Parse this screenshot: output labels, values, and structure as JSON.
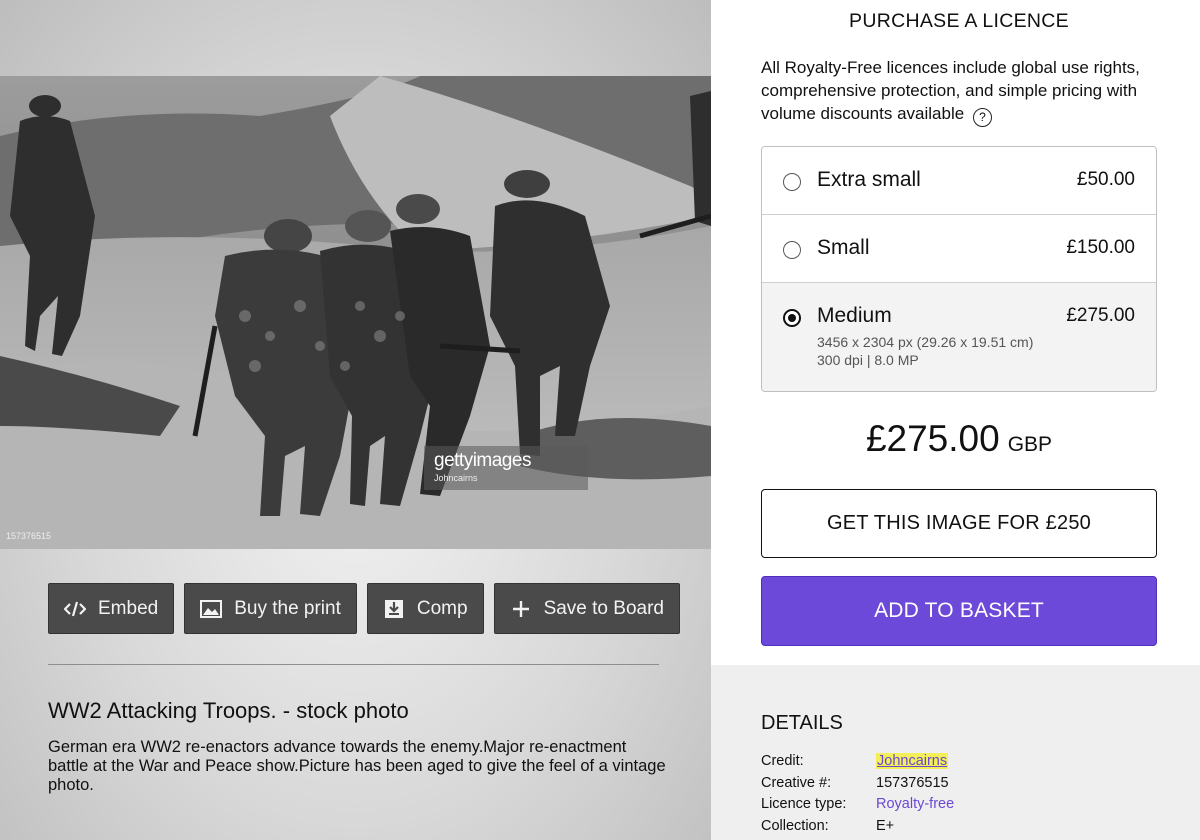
{
  "image": {
    "watermark_brand": "gettyimages",
    "watermark_credit": "Johncairns",
    "photo_id": "157376515"
  },
  "actions": [
    {
      "label": "Embed",
      "icon": "code-icon"
    },
    {
      "label": "Buy the print",
      "icon": "image-icon"
    },
    {
      "label": "Comp",
      "icon": "download-icon"
    },
    {
      "label": "Save to Board",
      "icon": "plus-icon"
    }
  ],
  "photo": {
    "title": "WW2 Attacking Troops. - stock photo",
    "description": "German era WW2 re-enactors advance towards the enemy.Major re-enactment battle at the War and Peace show.Picture has been aged to give the feel of a vintage photo."
  },
  "licence": {
    "heading": "PURCHASE A LICENCE",
    "info": "All Royalty-Free licences include global use rights, comprehensive protection, and simple pricing with volume discounts available",
    "help_icon": "question-circle-icon",
    "options": [
      {
        "name": "Extra small",
        "price": "£50.00",
        "selected": false
      },
      {
        "name": "Small",
        "price": "£150.00",
        "selected": false
      },
      {
        "name": "Medium",
        "price": "£275.00",
        "selected": true,
        "spec_line1": "3456 x 2304 px (29.26 x 19.51 cm)",
        "spec_line2": "300 dpi | 8.0 MP"
      }
    ],
    "total_amount": "£275.00",
    "total_currency": "GBP",
    "get_image_label": "GET THIS IMAGE FOR £250",
    "basket_label": "ADD TO BASKET"
  },
  "details": {
    "heading": "DETAILS",
    "rows": [
      {
        "key": "Credit:",
        "value": "Johncairns"
      },
      {
        "key": "Creative #:",
        "value": "157376515"
      },
      {
        "key": "Licence type:",
        "value": "Royalty-free"
      },
      {
        "key": "Collection:",
        "value": "E+"
      }
    ]
  },
  "colors": {
    "accent_purple": "#6c49d8",
    "highlight_yellow": "#f3ef58"
  }
}
